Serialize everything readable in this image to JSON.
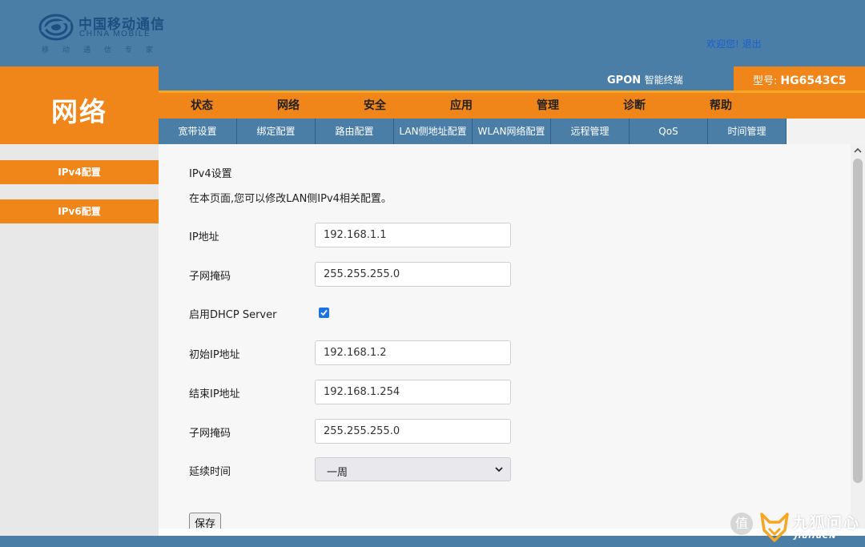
{
  "header": {
    "logo_cn": "中国移动通信",
    "logo_en": "CHINA MOBILE",
    "logo_tagline": "移动通信专家",
    "welcome": "欢迎您!",
    "logout": "退出"
  },
  "section_title": "网络",
  "topbar": {
    "gpon": "GPON",
    "gpon_sub": "智能终端",
    "model_label": "型号:",
    "model_value": "HG6543C5"
  },
  "main_nav": [
    "状态",
    "网络",
    "安全",
    "应用",
    "管理",
    "诊断",
    "帮助"
  ],
  "sub_nav": [
    "宽带设置",
    "绑定配置",
    "路由配置",
    "LAN侧地址配置",
    "WLAN网络配置",
    "远程管理",
    "QoS",
    "时间管理"
  ],
  "sidebar": {
    "items": [
      "IPv4配置",
      "IPv6配置"
    ]
  },
  "form": {
    "heading": "IPv4设置",
    "description": "在本页面,您可以修改LAN侧IPv4相关配置。",
    "ip_label": "IP地址",
    "ip_value": "192.168.1.1",
    "mask_label": "子网掩码",
    "mask_value": "255.255.255.0",
    "dhcp_label": "启用DHCP Server",
    "dhcp_enabled": true,
    "start_ip_label": "初始IP地址",
    "start_ip_value": "192.168.1.2",
    "end_ip_label": "结束IP地址",
    "end_ip_value": "192.168.1.254",
    "dhcp_mask_label": "子网掩码",
    "dhcp_mask_value": "255.255.255.0",
    "lease_label": "延续时间",
    "lease_value": "一周",
    "save_label": "保存"
  },
  "watermark": {
    "badge": "值",
    "text": "九狐问心",
    "sub": "JiuHuCN"
  },
  "colors": {
    "header_blue": "#4a7ea7",
    "orange": "#f08519",
    "link_blue": "#1a5fd0",
    "checkbox_blue": "#1a73e8"
  },
  "icons": {
    "logo": "china-mobile-logo-icon",
    "checkbox": "check-icon",
    "select": "chevron-down-icon",
    "scroll": "scroll-up-arrow-icon"
  }
}
